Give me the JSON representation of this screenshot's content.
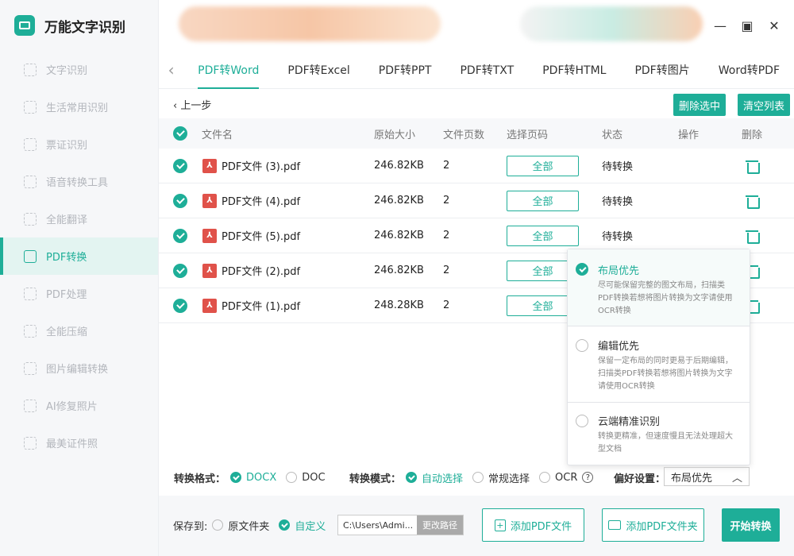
{
  "app": {
    "title": "万能文字识别"
  },
  "sidebar": {
    "items": [
      {
        "label": "文字识别",
        "active": false
      },
      {
        "label": "生活常用识别",
        "active": false
      },
      {
        "label": "票证识别",
        "active": false
      },
      {
        "label": "语音转换工具",
        "active": false
      },
      {
        "label": "全能翻译",
        "active": false
      },
      {
        "label": "PDF转换",
        "active": true
      },
      {
        "label": "PDF处理",
        "active": false
      },
      {
        "label": "全能压缩",
        "active": false
      },
      {
        "label": "图片编辑转换",
        "active": false
      },
      {
        "label": "AI修复照片",
        "active": false
      },
      {
        "label": "最美证件照",
        "active": false
      }
    ]
  },
  "window": {
    "minimize": "—",
    "maximize": "▣",
    "close": "✕"
  },
  "tabs": [
    "PDF转Word",
    "PDF转Excel",
    "PDF转PPT",
    "PDF转TXT",
    "PDF转HTML",
    "PDF转图片",
    "Word转PDF"
  ],
  "toolbar": {
    "back_label": "上一步",
    "delete_selected": "删除选中",
    "clear_list": "清空列表"
  },
  "table": {
    "headers": {
      "name": "文件名",
      "size": "原始大小",
      "pages": "文件页数",
      "range": "选择页码",
      "status": "状态",
      "action": "操作",
      "delete": "删除"
    },
    "rows": [
      {
        "name": "PDF文件 (3).pdf",
        "size": "246.82KB",
        "pages": "2",
        "range": "全部",
        "status": "待转换"
      },
      {
        "name": "PDF文件 (4).pdf",
        "size": "246.82KB",
        "pages": "2",
        "range": "全部",
        "status": "待转换"
      },
      {
        "name": "PDF文件 (5).pdf",
        "size": "246.82KB",
        "pages": "2",
        "range": "全部",
        "status": "待转换"
      },
      {
        "name": "PDF文件 (2).pdf",
        "size": "246.82KB",
        "pages": "2",
        "range": "全部",
        "status": ""
      },
      {
        "name": "PDF文件 (1).pdf",
        "size": "248.28KB",
        "pages": "2",
        "range": "全部",
        "status": ""
      }
    ]
  },
  "preference_popup": {
    "options": [
      {
        "title": "布局优先",
        "desc": "尽可能保留完整的图文布局，扫描类PDF转换若想将图片转换为文字请使用OCR转换",
        "selected": true
      },
      {
        "title": "编辑优先",
        "desc": "保留一定布局的同时更易于后期编辑，扫描类PDF转换若想将图片转换为文字请使用OCR转换",
        "selected": false
      },
      {
        "title": "云端精准识别",
        "desc": "转换更精准，但速度慢且无法处理超大型文档",
        "selected": false
      }
    ]
  },
  "settings": {
    "format_label": "转换格式：",
    "format_docx": "DOCX",
    "format_doc": "DOC",
    "mode_label": "转换模式：",
    "mode_auto": "自动选择",
    "mode_normal": "常规选择",
    "mode_ocr": "OCR",
    "help": "?",
    "pref_label": "偏好设置：",
    "pref_value": "布局优先",
    "pref_arrow": "︿"
  },
  "bottom": {
    "save_label": "保存到:",
    "save_original": "原文件夹",
    "save_custom": "自定义",
    "path_value": "C:\\Users\\Admi...",
    "change_path": "更改路径",
    "add_file": "添加PDF文件",
    "add_folder": "添加PDF文件夹",
    "start": "开始转换"
  },
  "colors": {
    "accent": "#1eae98",
    "pdf_red": "#e0524a"
  }
}
